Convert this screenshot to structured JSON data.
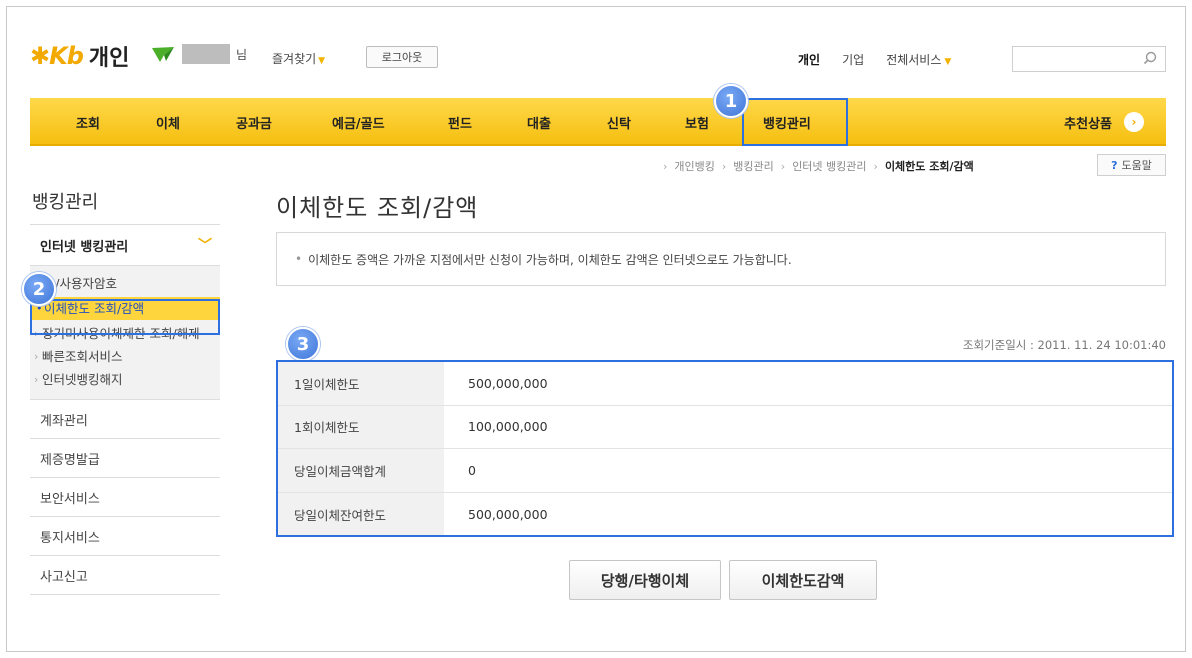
{
  "header": {
    "logo_mark": "K",
    "logo_text": "개인",
    "user_suffix": "님",
    "favorites_label": "즐겨찾기",
    "logout_label": "로그아웃",
    "top_links": [
      "개인",
      "기업",
      "전체서비스"
    ],
    "search_placeholder": ""
  },
  "gnb": {
    "items": [
      "조회",
      "이체",
      "공과금",
      "예금/골드",
      "펀드",
      "대출",
      "신탁",
      "보험",
      "뱅킹관리"
    ],
    "recommend_label": "추천상품",
    "recommend_icon": "chevron-right-icon"
  },
  "badges": [
    "1",
    "2",
    "3"
  ],
  "breadcrumb": {
    "items": [
      "개인뱅킹",
      "뱅킹관리",
      "인터넷 뱅킹관리"
    ],
    "current": "이체한도 조회/감액",
    "help_label": "도움말"
  },
  "sidebar": {
    "title": "뱅킹관리",
    "section_label": "인터넷 뱅킹관리",
    "sub_items": [
      "ID/사용자암호",
      "이체한도 조회/감액",
      "장기미사용이체제한 조회/해제",
      "빠른조회서비스",
      "인터넷뱅킹해지"
    ],
    "menu_items": [
      "계좌관리",
      "제증명발급",
      "보안서비스",
      "통지서비스",
      "사고신고"
    ]
  },
  "main": {
    "title": "이체한도 조회/감액",
    "notice": "이체한도 증액은 가까운 지점에서만 신청이 가능하며, 이체한도 감액은 인터넷으로도 가능합니다.",
    "query_time": "조회기준일시 : 2011. 11. 24 10:01:40",
    "rows": [
      {
        "label": "1일이체한도",
        "value": "500,000,000"
      },
      {
        "label": "1회이체한도",
        "value": "100,000,000"
      },
      {
        "label": "당일이체금액합계",
        "value": "0"
      },
      {
        "label": "당일이체잔여한도",
        "value": "500,000,000"
      }
    ],
    "buttons": [
      "당행/타행이체",
      "이체한도감액"
    ]
  },
  "colors": {
    "gnb_yellow": "#f5bf10",
    "highlight_blue": "#2e6fe0",
    "active_sub_bg": "#ffd53d"
  }
}
